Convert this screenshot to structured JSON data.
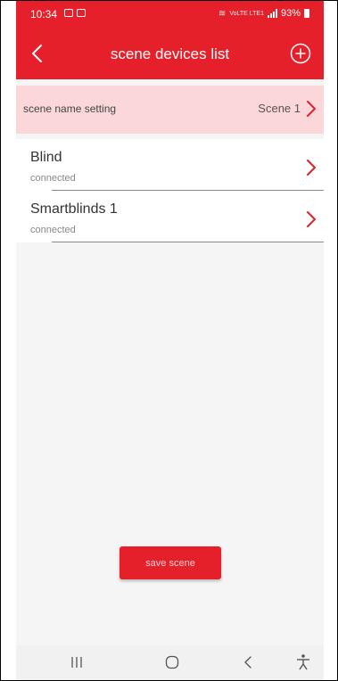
{
  "status_bar": {
    "time": "10:34",
    "network_text": "VoLTE LTE1",
    "battery": "93%"
  },
  "header": {
    "title": "scene devices list",
    "back_icon": "chevron-left-icon",
    "add_icon": "plus-circle-icon"
  },
  "scene_setting": {
    "label": "scene name setting",
    "value": "Scene 1"
  },
  "devices": [
    {
      "name": "Blind",
      "status": "connected"
    },
    {
      "name": "Smartblinds 1",
      "status": "connected"
    }
  ],
  "save_button": {
    "label": "save scene"
  },
  "nav_bar": {
    "icons": [
      "recents-icon",
      "home-icon",
      "back-icon",
      "accessibility-icon"
    ]
  },
  "colors": {
    "accent": "#e5202a",
    "scene_row_bg": "#fcd7da",
    "page_bg": "#f5f5f5"
  }
}
